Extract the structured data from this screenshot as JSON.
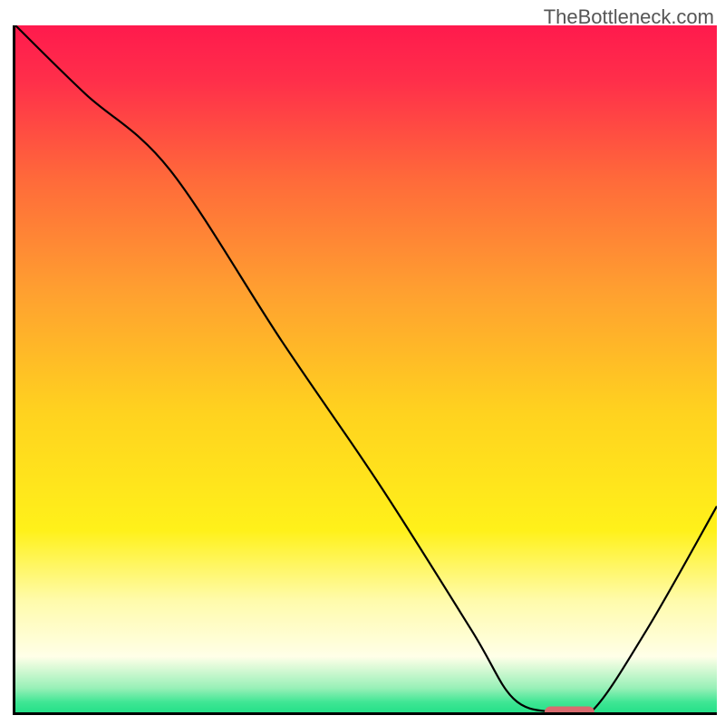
{
  "watermark": "TheBottleneck.com",
  "chart_data": {
    "type": "line",
    "title": "",
    "xlabel": "",
    "ylabel": "",
    "xlim": [
      0,
      100
    ],
    "ylim": [
      0,
      100
    ],
    "gradient_stops": [
      {
        "pos": 0.0,
        "color": "#ff1a4d"
      },
      {
        "pos": 0.08,
        "color": "#ff2f4a"
      },
      {
        "pos": 0.22,
        "color": "#ff6a3a"
      },
      {
        "pos": 0.38,
        "color": "#ffa030"
      },
      {
        "pos": 0.55,
        "color": "#ffd21f"
      },
      {
        "pos": 0.72,
        "color": "#fff11a"
      },
      {
        "pos": 0.82,
        "color": "#fffbab"
      },
      {
        "pos": 0.9,
        "color": "#ffffe8"
      },
      {
        "pos": 0.945,
        "color": "#97f0b7"
      },
      {
        "pos": 0.965,
        "color": "#3fe694"
      },
      {
        "pos": 1.0,
        "color": "#00d877"
      }
    ],
    "series": [
      {
        "name": "bottleneck-curve",
        "x": [
          0,
          10,
          22,
          38,
          52,
          65,
          71,
          77,
          82,
          90,
          100
        ],
        "y": [
          100,
          90,
          79,
          54,
          33,
          12,
          2,
          0,
          0,
          12,
          30
        ]
      }
    ],
    "marker": {
      "x_center": 79,
      "y": 0,
      "width_pct": 7
    }
  }
}
